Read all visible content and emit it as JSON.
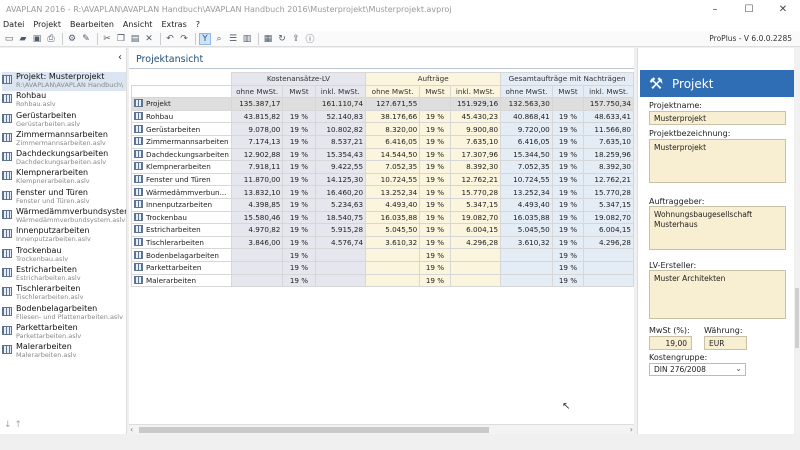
{
  "window": {
    "title": "AVAPLAN 2016 - R:\\AVAPLAN\\AVAPLAN Handbuch\\AVAPLAN Handbuch 2016\\Musterprojekt\\Musterprojekt.avproj",
    "minimize": "–",
    "maximize": "☐",
    "close": "✕"
  },
  "menu": [
    "Datei",
    "Projekt",
    "Bearbeiten",
    "Ansicht",
    "Extras",
    "?"
  ],
  "toolbar": {
    "version": "ProPlus - V 6.0.0.2285"
  },
  "tree": {
    "collapse": "‹",
    "items": [
      {
        "name": "Projekt: Musterprojekt",
        "sub": "R:\\AVAPLAN\\AVAPLAN Handbuch\\",
        "selected": true
      },
      {
        "name": "Rohbau",
        "sub": "Rohbau.aslv"
      },
      {
        "name": "Gerüstarbeiten",
        "sub": "Gerüstarbeiten.aslv"
      },
      {
        "name": "Zimmermannsarbeiten",
        "sub": "Zimmermannsarbeiten.aslv"
      },
      {
        "name": "Dachdeckungsarbeiten",
        "sub": "Dachdeckungsarbeiten.aslv"
      },
      {
        "name": "Klempnerarbeiten",
        "sub": "Klempnerarbeiten.aslv"
      },
      {
        "name": "Fenster und Türen",
        "sub": "Fenster und Türen.aslv"
      },
      {
        "name": "Wärmedämmverbundsystem",
        "sub": "Wärmedämmverbundsystem.aslv"
      },
      {
        "name": "Innenputzarbeiten",
        "sub": "Innenputzarbeiten.aslv"
      },
      {
        "name": "Trockenbau",
        "sub": "Trockenbau.aslv"
      },
      {
        "name": "Estricharbeiten",
        "sub": "Estricharbeiten.aslv"
      },
      {
        "name": "Tischlerarbeiten",
        "sub": "Tischlerarbeiten.aslv"
      },
      {
        "name": "Bodenbelagarbeiten",
        "sub": "Fliesen- und Plattenarbeiten.aslv"
      },
      {
        "name": "Parkettarbeiten",
        "sub": "Parkettarbeiten.aslv"
      },
      {
        "name": "Malerarbeiten",
        "sub": "Malerarbeiten.aslv"
      }
    ]
  },
  "main": {
    "heading": "Projektansicht",
    "groups": [
      "Kostenansätze-LV",
      "Aufträge",
      "Gesamtaufträge mit Nachträgen"
    ],
    "subheaders": [
      "ohne MwSt.",
      "MwSt",
      "inkl. MwSt."
    ],
    "rows": [
      {
        "name": "Projekt",
        "v": [
          "135.387,17",
          "",
          "161.110,74",
          "127.671,55",
          "",
          "151.929,16",
          "132.563,30",
          "",
          "157.750,34"
        ]
      },
      {
        "name": "Rohbau",
        "v": [
          "43.815,82",
          "19 %",
          "52.140,83",
          "38.176,66",
          "19 %",
          "45.430,23",
          "40.868,41",
          "19 %",
          "48.633,41"
        ]
      },
      {
        "name": "Gerüstarbeiten",
        "v": [
          "9.078,00",
          "19 %",
          "10.802,82",
          "8.320,00",
          "19 %",
          "9.900,80",
          "9.720,00",
          "19 %",
          "11.566,80"
        ]
      },
      {
        "name": "Zimmermannsarbeiten",
        "v": [
          "7.174,13",
          "19 %",
          "8.537,21",
          "6.416,05",
          "19 %",
          "7.635,10",
          "6.416,05",
          "19 %",
          "7.635,10"
        ]
      },
      {
        "name": "Dachdeckungsarbeiten",
        "v": [
          "12.902,88",
          "19 %",
          "15.354,43",
          "14.544,50",
          "19 %",
          "17.307,96",
          "15.344,50",
          "19 %",
          "18.259,96"
        ]
      },
      {
        "name": "Klempnerarbeiten",
        "v": [
          "7.918,11",
          "19 %",
          "9.422,55",
          "7.052,35",
          "19 %",
          "8.392,30",
          "7.052,35",
          "19 %",
          "8.392,30"
        ]
      },
      {
        "name": "Fenster und Türen",
        "v": [
          "11.870,00",
          "19 %",
          "14.125,30",
          "10.724,55",
          "19 %",
          "12.762,21",
          "10.724,55",
          "19 %",
          "12.762,21"
        ]
      },
      {
        "name": "Wärmedämmverbun...",
        "v": [
          "13.832,10",
          "19 %",
          "16.460,20",
          "13.252,34",
          "19 %",
          "15.770,28",
          "13.252,34",
          "19 %",
          "15.770,28"
        ]
      },
      {
        "name": "Innenputzarbeiten",
        "v": [
          "4.398,85",
          "19 %",
          "5.234,63",
          "4.493,40",
          "19 %",
          "5.347,15",
          "4.493,40",
          "19 %",
          "5.347,15"
        ]
      },
      {
        "name": "Trockenbau",
        "v": [
          "15.580,46",
          "19 %",
          "18.540,75",
          "16.035,88",
          "19 %",
          "19.082,70",
          "16.035,88",
          "19 %",
          "19.082,70"
        ]
      },
      {
        "name": "Estricharbeiten",
        "v": [
          "4.970,82",
          "19 %",
          "5.915,28",
          "5.045,50",
          "19 %",
          "6.004,15",
          "5.045,50",
          "19 %",
          "6.004,15"
        ]
      },
      {
        "name": "Tischlerarbeiten",
        "v": [
          "3.846,00",
          "19 %",
          "4.576,74",
          "3.610,32",
          "19 %",
          "4.296,28",
          "3.610,32",
          "19 %",
          "4.296,28"
        ]
      },
      {
        "name": "Bodenbelagarbeiten",
        "v": [
          "",
          "19 %",
          "",
          "",
          "19 %",
          "",
          "",
          "19 %",
          ""
        ]
      },
      {
        "name": "Parkettarbeiten",
        "v": [
          "",
          "19 %",
          "",
          "",
          "19 %",
          "",
          "",
          "19 %",
          ""
        ]
      },
      {
        "name": "Malerarbeiten",
        "v": [
          "",
          "19 %",
          "",
          "",
          "19 %",
          "",
          "",
          "19 %",
          ""
        ]
      }
    ]
  },
  "panel": {
    "title": "Projekt",
    "projektname_label": "Projektname:",
    "projektname": "Musterprojekt",
    "bezeichnung_label": "Projektbezeichnung:",
    "bezeichnung": "Musterprojekt",
    "auftraggeber_label": "Auftraggeber:",
    "auftraggeber_1": "Wohnungsbaugesellschaft",
    "auftraggeber_2": "Musterhaus",
    "ersteller_label": "LV-Ersteller:",
    "ersteller": "Muster Architekten",
    "mwst_label": "MwSt (%):",
    "mwst": "19,00",
    "waehrung_label": "Währung:",
    "waehrung": "EUR",
    "kostengruppe_label": "Kostengruppe:",
    "kostengruppe": "DIN 276/2008"
  }
}
